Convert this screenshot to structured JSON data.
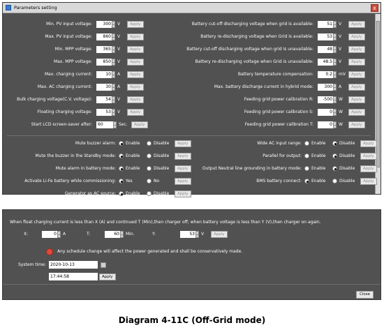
{
  "window": {
    "title": "Parameters setting",
    "close": "x"
  },
  "left_params": [
    {
      "label": "Min. PV input voltage:",
      "value": "300",
      "unit": "V",
      "button": "Apply"
    },
    {
      "label": "Max. PV input voltage:",
      "value": "860",
      "unit": "V",
      "button": "Apply"
    },
    {
      "label": "Min. MPP voltage:",
      "value": "365",
      "unit": "V",
      "button": "Apply"
    },
    {
      "label": "Max. MPP voltage:",
      "value": "850",
      "unit": "V",
      "button": "Apply"
    },
    {
      "label": "Max. charging current:",
      "value": "10",
      "unit": "A",
      "button": "Apply"
    },
    {
      "label": "Max. AC charging current:",
      "value": "30",
      "unit": "A",
      "button": "Apply"
    },
    {
      "label": "Bulk charging voltage(C.V. voltage):",
      "value": "54",
      "unit": "V",
      "button": "Apply"
    },
    {
      "label": "Floating charging voltage:",
      "value": "53",
      "unit": "V",
      "button": "Apply"
    }
  ],
  "lcd": {
    "label": "Start LCD screen-saver after:",
    "value": "60",
    "unit": "Sec.",
    "button": "Apply"
  },
  "right_params": [
    {
      "label": "Battery cut-off discharging voltage when grid is available:",
      "value": "51",
      "unit": "V",
      "button": "Apply"
    },
    {
      "label": "Battery re-discharging voltage when Grid is available:",
      "value": "53",
      "unit": "V",
      "button": "Apply"
    },
    {
      "label": "Battery cut-off discharging voltage when grid is unavailable:",
      "value": "48",
      "unit": "V",
      "button": "Apply"
    },
    {
      "label": "Battery re-discharging voltage when Grid is unavailable:",
      "value": "48.5",
      "unit": "V",
      "button": "Apply"
    },
    {
      "label": "Battery temperature compensation:",
      "value": "0.2",
      "unit": "mV",
      "button": "Apply"
    },
    {
      "label": "Max. battery discharge current in hybrid mode:",
      "value": "300",
      "unit": "A",
      "button": "Apply"
    },
    {
      "label": "Feeding grid power calibration R:",
      "value": "-500",
      "unit": "W",
      "button": "Apply"
    },
    {
      "label": "Feeding grid power calibration S:",
      "value": "0",
      "unit": "W",
      "button": "Apply"
    },
    {
      "label": "Feeding grid power calibration T:",
      "value": "0",
      "unit": "W",
      "button": "Apply"
    }
  ],
  "left_toggles": [
    {
      "label": "Mute buzzer alarm:",
      "opt1": "Enable",
      "opt2": "Disable",
      "selected": 1,
      "button": "Apply"
    },
    {
      "label": "Mute the buzzer in the Standby mode:",
      "opt1": "Enable",
      "opt2": "Disable",
      "selected": 1,
      "button": "Apply"
    },
    {
      "label": "Mute alarm in battery mode:",
      "opt1": "Enable",
      "opt2": "Disable",
      "selected": 1,
      "button": "Apply"
    },
    {
      "label": "Activate Li-Fe battery while commissioning:",
      "opt1": "Yes",
      "opt2": "No",
      "selected": 1,
      "button": "Apply"
    },
    {
      "label": "Generator as AC source:",
      "opt1": "Enable",
      "opt2": "Disable",
      "selected": 1,
      "button": "Apply"
    }
  ],
  "right_toggles": [
    {
      "label": "Wide AC input range:",
      "opt1": "Enable",
      "opt2": "Disable",
      "selected": 2,
      "button": "Apply"
    },
    {
      "label": "Parallel for output:",
      "opt1": "Enable",
      "opt2": "Disable",
      "selected": 2,
      "button": "Apply"
    },
    {
      "label": "Output Neutral line grounding in battery mode:",
      "opt1": "Enable",
      "opt2": "Disable",
      "selected": 2,
      "button": "Apply"
    },
    {
      "label": "BMS battery connect:",
      "opt1": "Enable",
      "opt2": "Disable",
      "selected": 1,
      "button": "Apply"
    }
  ],
  "lower": {
    "note": "When float charging current is less than X (A) and continued T (Min),then charger off; when battery voltage is less than Y (V),then charger on again.",
    "x_label": "X:",
    "x_value": "0",
    "x_unit": "A",
    "t_label": "T:",
    "t_value": "60",
    "t_unit": "Min.",
    "y_label": "Y:",
    "y_value": "53",
    "y_unit": "V",
    "apply": "Apply",
    "warning": "Any schedule change will affect the power generated and shall be conservatively made.",
    "system_time_label": "System time:",
    "date": "2020-10-13",
    "time": "17:44:58",
    "time_apply": "Apply",
    "close": "Close"
  },
  "caption": "Diagram 4-11C (Off-Grid mode)"
}
